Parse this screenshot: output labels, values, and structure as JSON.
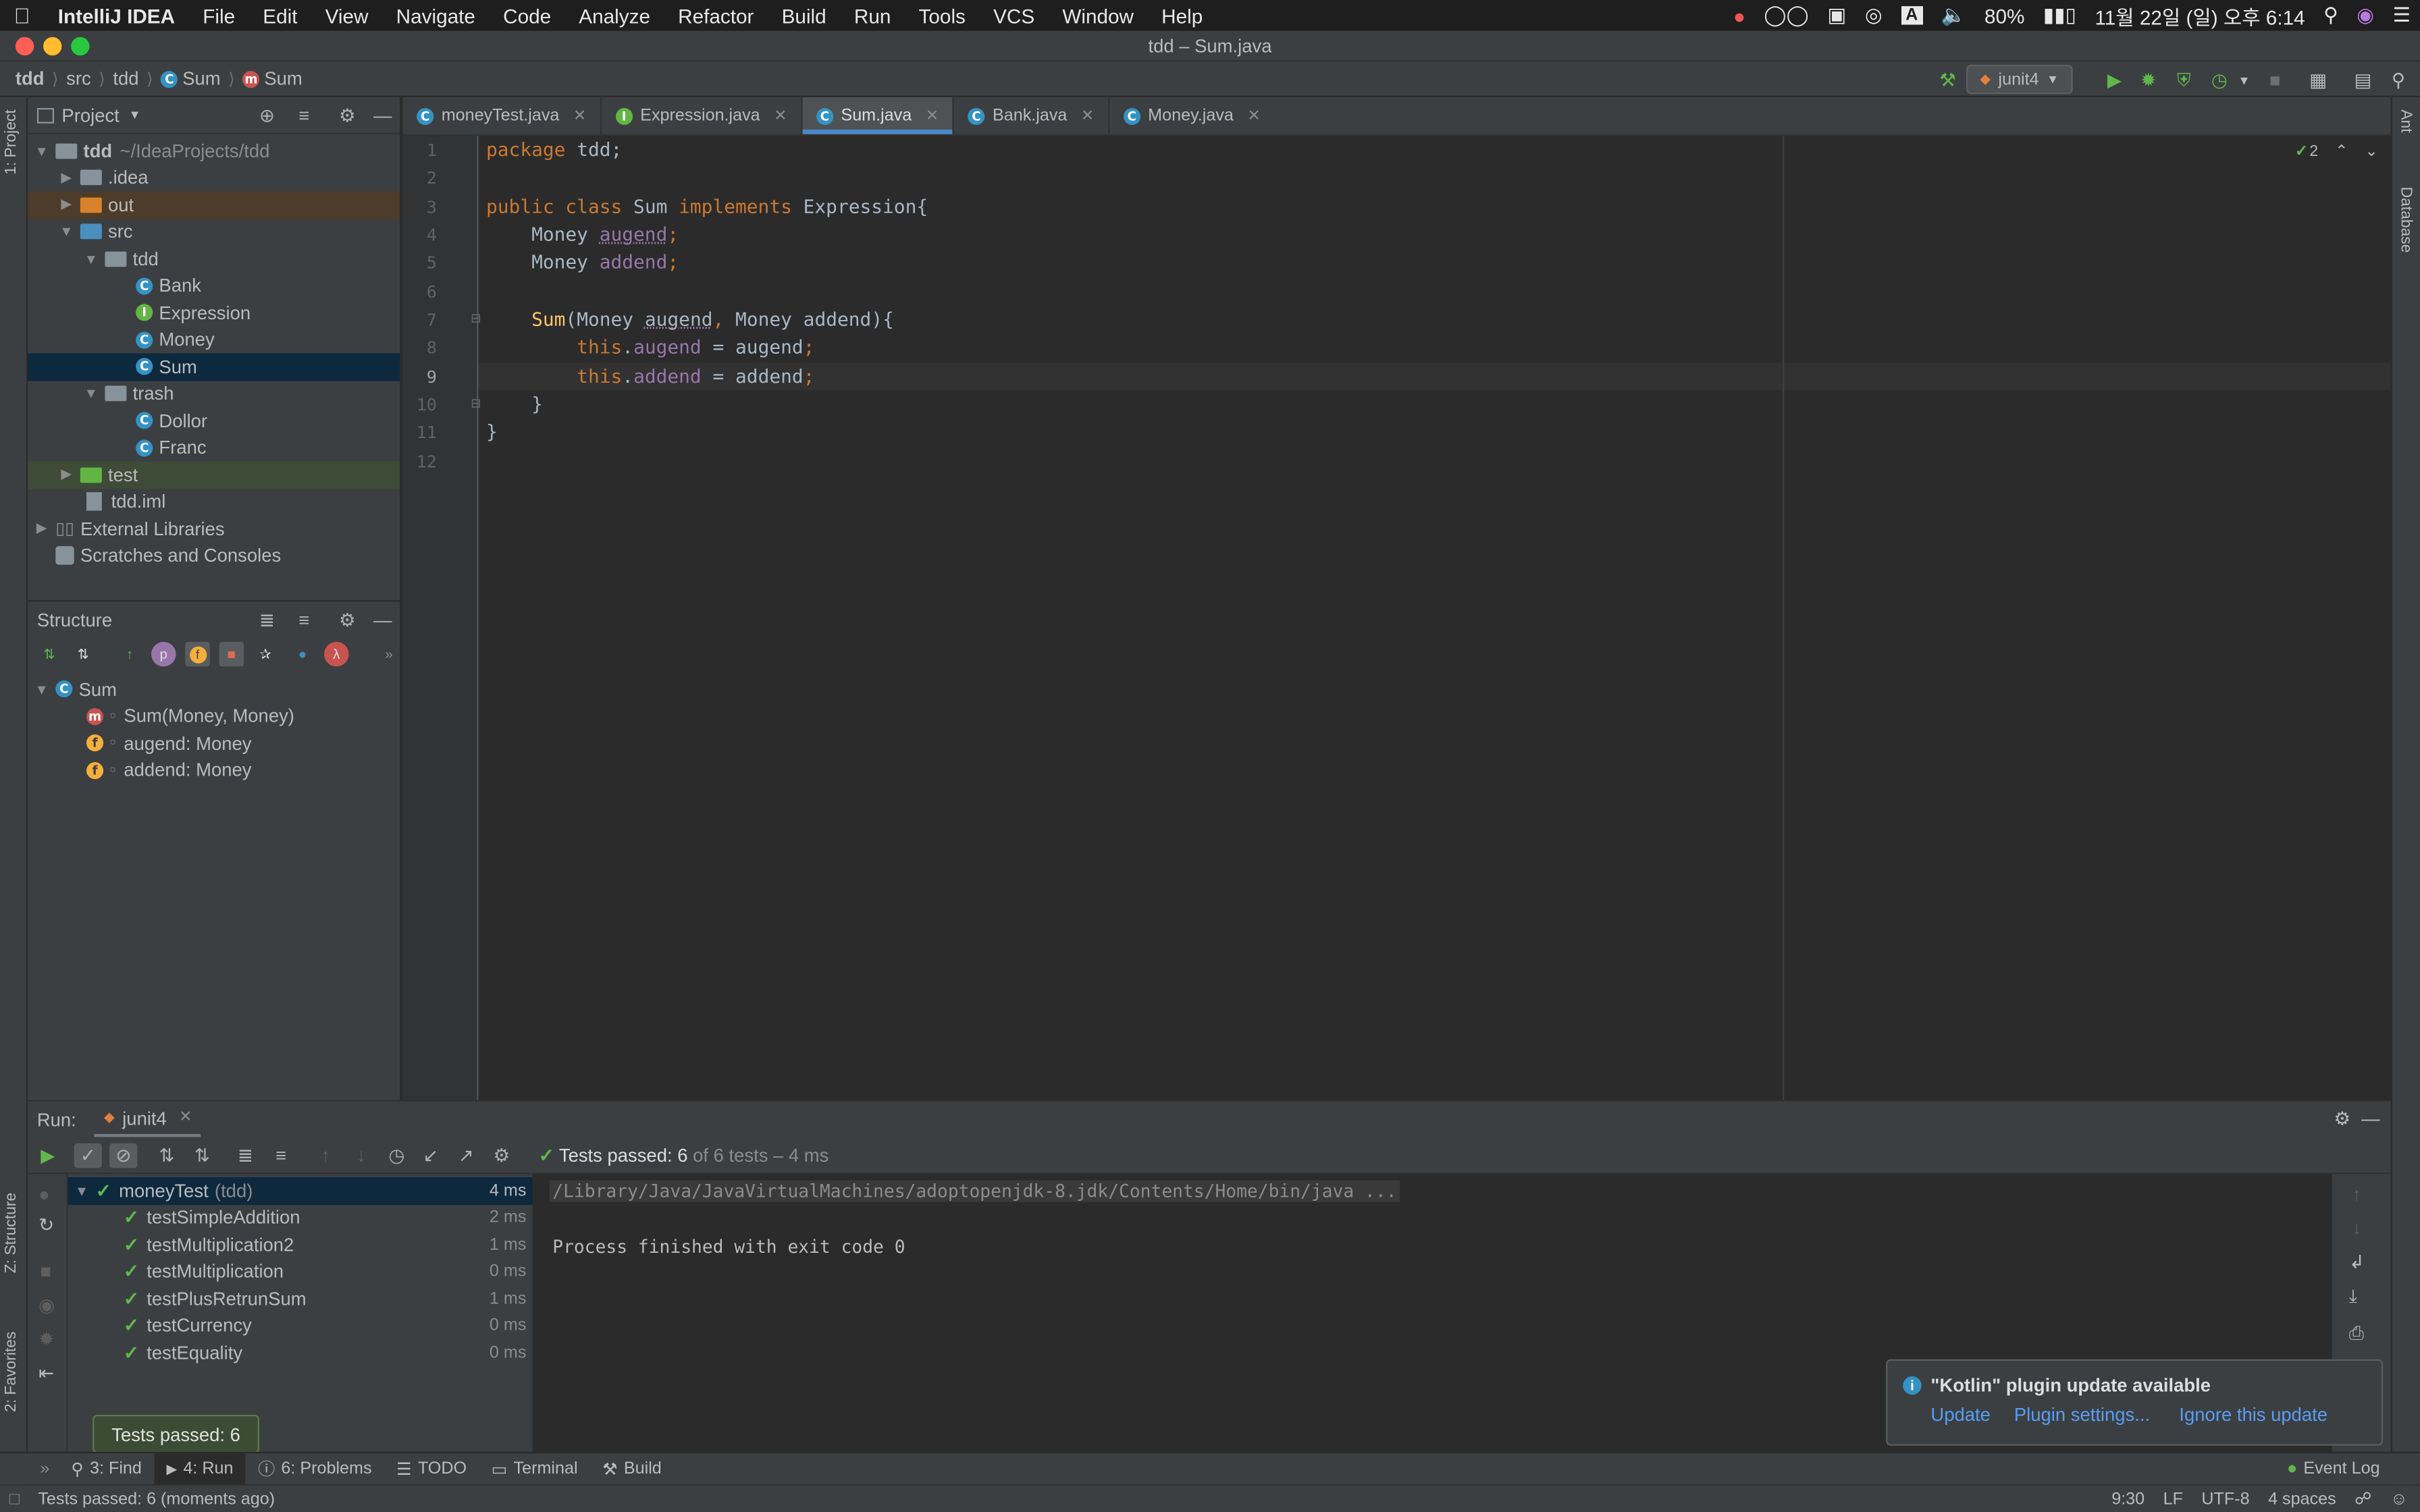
{
  "menubar": {
    "app_name": "IntelliJ IDEA",
    "items": [
      "File",
      "Edit",
      "View",
      "Navigate",
      "Code",
      "Analyze",
      "Refactor",
      "Build",
      "Run",
      "Tools",
      "VCS",
      "Window",
      "Help"
    ],
    "battery": "80%",
    "datetime": "11월 22일 (일) 오후 6:14",
    "input_source": "A"
  },
  "window": {
    "title": "tdd – Sum.java"
  },
  "breadcrumbs": [
    "tdd",
    "src",
    "tdd",
    "Sum",
    "Sum"
  ],
  "toolbar": {
    "run_config": "junit4"
  },
  "project_panel": {
    "title": "Project",
    "root_name": "tdd",
    "root_path": "~/IdeaProjects/tdd",
    "items": [
      {
        "label": ".idea"
      },
      {
        "label": "out"
      },
      {
        "label": "src"
      },
      {
        "label": "tdd"
      },
      {
        "label": "Bank"
      },
      {
        "label": "Expression"
      },
      {
        "label": "Money"
      },
      {
        "label": "Sum"
      },
      {
        "label": "trash"
      },
      {
        "label": "Dollor"
      },
      {
        "label": "Franc"
      },
      {
        "label": "test"
      },
      {
        "label": "tdd.iml"
      },
      {
        "label": "External Libraries"
      },
      {
        "label": "Scratches and Consoles"
      }
    ]
  },
  "structure_panel": {
    "title": "Structure",
    "root": "Sum",
    "members": [
      "Sum(Money, Money)",
      "augend: Money",
      "addend: Money"
    ]
  },
  "editor": {
    "tabs": [
      {
        "label": "moneyTest.java"
      },
      {
        "label": "Expression.java"
      },
      {
        "label": "Sum.java"
      },
      {
        "label": "Bank.java"
      },
      {
        "label": "Money.java"
      }
    ],
    "inspection_count": "2",
    "line_numbers": [
      "1",
      "2",
      "3",
      "4",
      "5",
      "6",
      "7",
      "8",
      "9",
      "10",
      "11",
      "12"
    ]
  },
  "left_strip": {
    "project_tab": "1: Project",
    "structure_tab": "Z: Structure",
    "favorites_tab": "2: Favorites"
  },
  "right_strip": {
    "ant_tab": "Ant",
    "database_tab": "Database"
  },
  "run_panel": {
    "label": "Run:",
    "config": "junit4",
    "status_prefix": "Tests passed:",
    "status_count": "6",
    "status_suffix": "of 6 tests – 4 ms",
    "root_test": "moneyTest",
    "root_pkg": "(tdd)",
    "root_time": "4 ms",
    "tests": [
      {
        "name": "testSimpleAddition",
        "time": "2 ms"
      },
      {
        "name": "testMultiplication2",
        "time": "1 ms"
      },
      {
        "name": "testMultiplication",
        "time": "0 ms"
      },
      {
        "name": "testPlusRetrunSum",
        "time": "1 ms"
      },
      {
        "name": "testCurrency",
        "time": "0 ms"
      },
      {
        "name": "testEquality",
        "time": "0 ms"
      }
    ],
    "console_line1": "/Library/Java/JavaVirtualMachines/adoptopenjdk-8.jdk/Contents/Home/bin/java ...",
    "console_line2": "Process finished with exit code 0"
  },
  "notification": {
    "title": "\"Kotlin\" plugin update available",
    "update": "Update",
    "settings": "Plugin settings...",
    "ignore": "Ignore this update"
  },
  "tooltip": {
    "text": "Tests passed: 6"
  },
  "bottom_tools": {
    "find": "3: Find",
    "run": "4: Run",
    "problems": "6: Problems",
    "todo": "TODO",
    "terminal": "Terminal",
    "build": "Build",
    "event_log": "Event Log"
  },
  "status_bar": {
    "message": "Tests passed: 6 (moments ago)",
    "position": "9:30",
    "line_sep": "LF",
    "encoding": "UTF-8",
    "indent": "4 spaces"
  },
  "colors": {
    "accent": "#4a88c7",
    "pass_green": "#5fb84c",
    "keyword": "#cc7832",
    "field": "#9876aa",
    "method": "#ffc66d"
  }
}
